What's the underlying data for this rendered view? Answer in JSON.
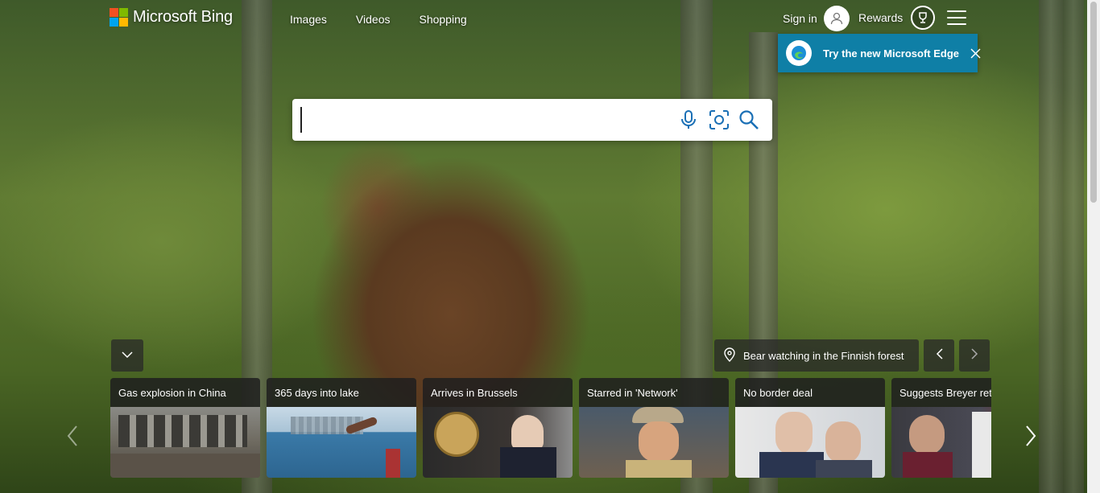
{
  "header": {
    "brand": "Microsoft Bing",
    "nav": [
      "Images",
      "Videos",
      "Shopping"
    ],
    "signin_label": "Sign in",
    "rewards_label": "Rewards"
  },
  "edge_banner": {
    "text": "Try the new Microsoft Edge"
  },
  "search": {
    "value": "",
    "placeholder": ""
  },
  "image_caption": "Bear watching in the Finnish forest",
  "news": [
    {
      "title": "Gas explosion in China"
    },
    {
      "title": "365 days into lake"
    },
    {
      "title": "Arrives in Brussels"
    },
    {
      "title": "Starred in 'Network'"
    },
    {
      "title": "No border deal"
    },
    {
      "title": "Suggests Breyer reti"
    }
  ],
  "colors": {
    "logo_red": "#f25022",
    "logo_green": "#7fba00",
    "logo_blue": "#00a4ef",
    "logo_yellow": "#ffb900",
    "edge_banner_bg": "#0f7fa6",
    "search_icon": "#1a6fb5"
  },
  "icons": [
    "microsoft-logo-icon",
    "user-icon",
    "trophy-icon",
    "hamburger-menu-icon",
    "edge-logo-icon",
    "close-icon",
    "microphone-icon",
    "visual-search-icon",
    "search-icon",
    "chevron-down-icon",
    "location-pin-icon",
    "chevron-left-icon",
    "chevron-right-icon"
  ]
}
